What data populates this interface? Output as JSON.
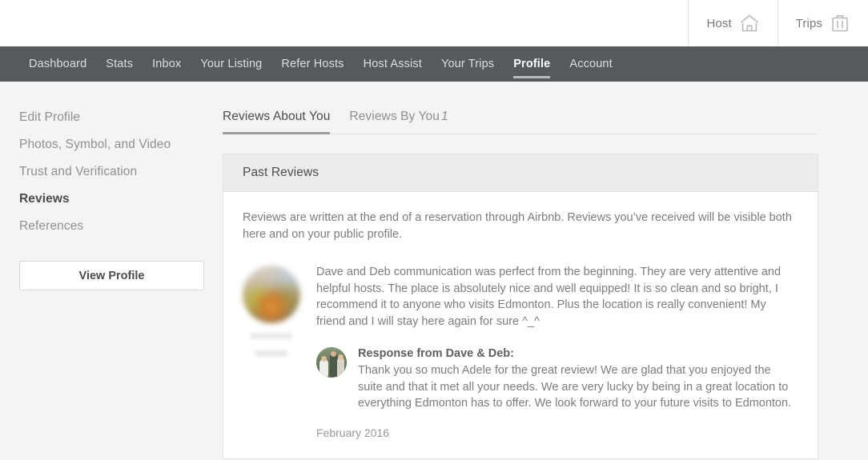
{
  "header": {
    "items": [
      {
        "label": "Host",
        "icon": "home-icon"
      },
      {
        "label": "Trips",
        "icon": "suitcase-icon"
      }
    ]
  },
  "navbar": {
    "items": [
      {
        "label": "Dashboard",
        "active": false
      },
      {
        "label": "Stats",
        "active": false
      },
      {
        "label": "Inbox",
        "active": false
      },
      {
        "label": "Your Listing",
        "active": false
      },
      {
        "label": "Refer Hosts",
        "active": false
      },
      {
        "label": "Host Assist",
        "active": false
      },
      {
        "label": "Your Trips",
        "active": false
      },
      {
        "label": "Profile",
        "active": true
      },
      {
        "label": "Account",
        "active": false
      }
    ]
  },
  "sidebar": {
    "items": [
      {
        "label": "Edit Profile",
        "active": false
      },
      {
        "label": "Photos, Symbol, and Video",
        "active": false
      },
      {
        "label": "Trust and Verification",
        "active": false
      },
      {
        "label": "Reviews",
        "active": true
      },
      {
        "label": "References",
        "active": false
      }
    ],
    "view_profile_label": "View Profile"
  },
  "tabs": [
    {
      "label": "Reviews About You",
      "count": "",
      "active": true
    },
    {
      "label": "Reviews By You",
      "count": "1",
      "active": false
    }
  ],
  "card": {
    "title": "Past Reviews",
    "intro": "Reviews are written at the end of a reservation through Airbnb. Reviews you’ve received will be visible both here and on your public profile."
  },
  "review": {
    "text": "Dave and Deb communication was perfect from the beginning. They are very attentive and helpful hosts. The place is absolutely nice and well equipped! It is so clean and so bright, I recommend it to anyone who visits Edmonton. Plus the location is really convenient! My friend and I will stay here again for sure ^_^",
    "response_title": "Response from Dave & Deb:",
    "response_text": "Thank you so much Adele for the great review! We are glad that you enjoyed the suite and that it met all your needs. We are very lucky by being in a great location to everything Edmonton has to offer. We look forward to your future visits to Edmonton.",
    "date": "February 2016"
  },
  "colors": {
    "navbar_bg": "#575a5c",
    "page_bg": "#f4f4f4",
    "card_header_bg": "#ebedeb",
    "text_muted": "#7b7d7f",
    "text_dark": "#4a4c4e"
  }
}
